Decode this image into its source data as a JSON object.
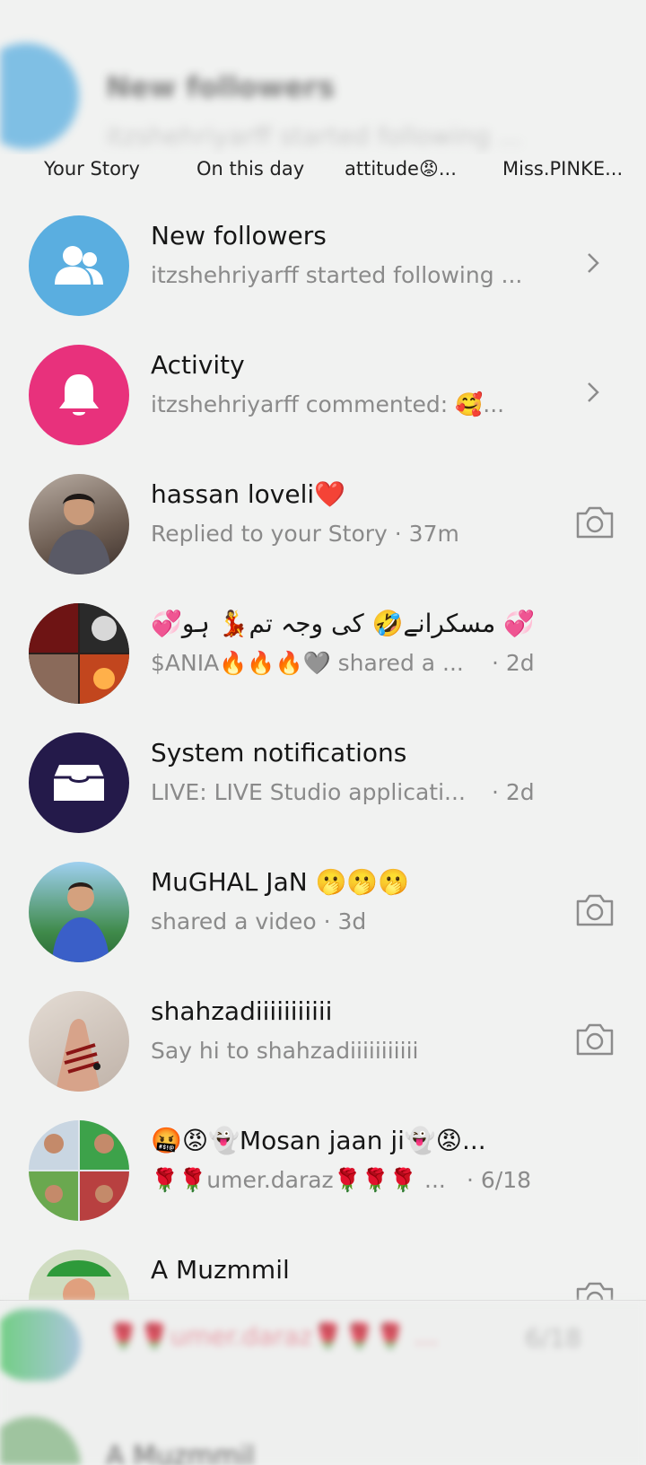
{
  "stories": [
    {
      "label": "Your Story"
    },
    {
      "label": "On this day"
    },
    {
      "label": "attitude😡..."
    },
    {
      "label": "Miss.PINKE..."
    }
  ],
  "ghost_header": {
    "title": "New followers",
    "subtitle": "itzshehriyarff started following ..."
  },
  "inbox": [
    {
      "title": "New followers",
      "subtitle": "itzshehriyarff started following ...",
      "time": "",
      "avatar": "people-icon",
      "avatar_color": "#5aaee0",
      "action": "chevron"
    },
    {
      "title": "Activity",
      "subtitle": "itzshehriyarff commented: 🥰...",
      "time": "",
      "avatar": "bell-icon",
      "avatar_color": "#e8317c",
      "action": "chevron"
    },
    {
      "title": "hassan loveli❤️",
      "subtitle": "Replied to your Story · 37m",
      "time": "",
      "avatar": "photo",
      "avatar_color": "#8a7a6e",
      "action": "camera"
    },
    {
      "title": "💞مسکرانے🤣 کی وجہ تم💃 ہو 💞",
      "subtitle": "$ANIA🔥🔥🔥🩶 shared a ...",
      "time": "· 2d",
      "avatar": "photo",
      "avatar_color": "#3a2a26",
      "action": ""
    },
    {
      "title": "System notifications",
      "subtitle": "LIVE: LIVE Studio applicati...",
      "time": "· 2d",
      "avatar": "inbox-icon",
      "avatar_color": "#241a4a",
      "action": ""
    },
    {
      "title": "MuGHAL JaN 🫢🫢🫢",
      "subtitle": "shared a video · 3d",
      "time": "",
      "avatar": "photo",
      "avatar_color": "#4d8fd0",
      "action": "camera"
    },
    {
      "title": "shahzadiiiiiiiiiii",
      "subtitle": "Say hi to shahzadiiiiiiiiiii",
      "time": "",
      "avatar": "photo",
      "avatar_color": "#cbbfb6",
      "action": "camera"
    },
    {
      "title": "🤬😡👻Mosan jaan ji👻😡...",
      "subtitle": "🌹🌹umer.daraz🌹🌹🌹 ...",
      "time": "· 6/18",
      "avatar": "photo",
      "avatar_color": "#7fa0c4",
      "action": ""
    },
    {
      "title": "A Muzmmil",
      "subtitle": "",
      "time": "",
      "avatar": "photo",
      "avatar_color": "#a7c98d",
      "action": "camera"
    }
  ],
  "bottom_ghost": {
    "row_text": "🌹🌹umer.daraz🌹🌹🌹 ...",
    "row_time": "6/18",
    "name": "A Muzmmil"
  },
  "colors": {
    "background": "#f1f2f1",
    "title_text": "#161616",
    "subtitle_text": "#8a8a8a",
    "icon_gray": "#8c8c8c"
  }
}
